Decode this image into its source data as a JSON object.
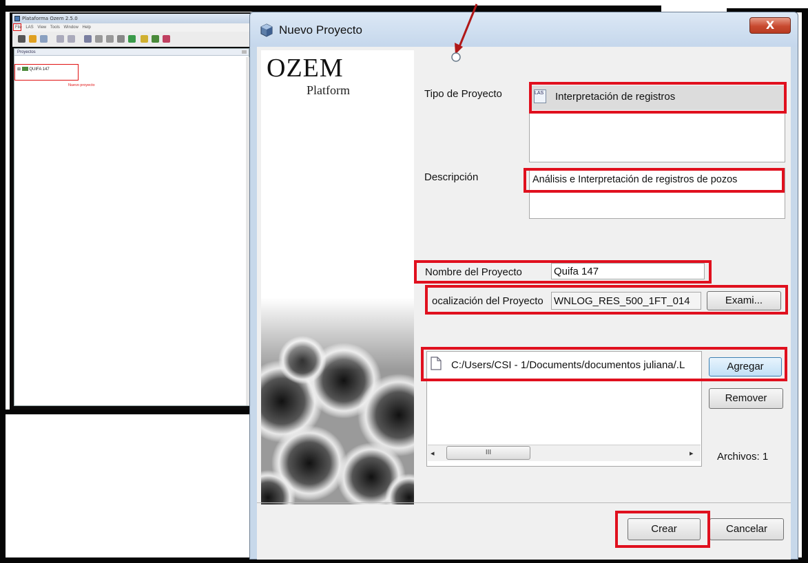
{
  "background_app": {
    "title": "Plataforma Ozem 2.5.0",
    "menus": [
      "File",
      "LAS",
      "View",
      "Tools",
      "Window",
      "Help"
    ],
    "panel_title": "Proyectos",
    "tree_item": "QUIFA 147",
    "annotation": "Nuevo proyecto"
  },
  "dialog": {
    "title": "Nuevo Proyecto",
    "close_label": "X",
    "brand": {
      "name": "OZEM",
      "subtitle": "Platform"
    },
    "tipo_label": "Tipo de Proyecto",
    "tipo_icon_text": "LAS",
    "tipo_value": "Interpretación de registros",
    "descripcion_label": "Descripción",
    "descripcion_value": "Análisis e Interpretación de registros de pozos",
    "nombre_label": "Nombre del Proyecto",
    "nombre_value": "Quifa 147",
    "localizacion_label": "ocalización del Proyecto",
    "localizacion_value": "WNLOG_RES_500_1FT_014",
    "examinar_label": "Exami...",
    "file_path": "C:/Users/CSI - 1/Documents/documentos juliana/.L",
    "agregar_label": "Agregar",
    "remover_label": "Remover",
    "scroll_thumb": "III",
    "archivos_label": "Archivos: 1",
    "crear_label": "Crear",
    "cancelar_label": "Cancelar"
  },
  "colors": {
    "highlight": "#e0101e",
    "dialog_frame": "#c7d8ea",
    "dialog_bg": "#f0f0f0"
  }
}
